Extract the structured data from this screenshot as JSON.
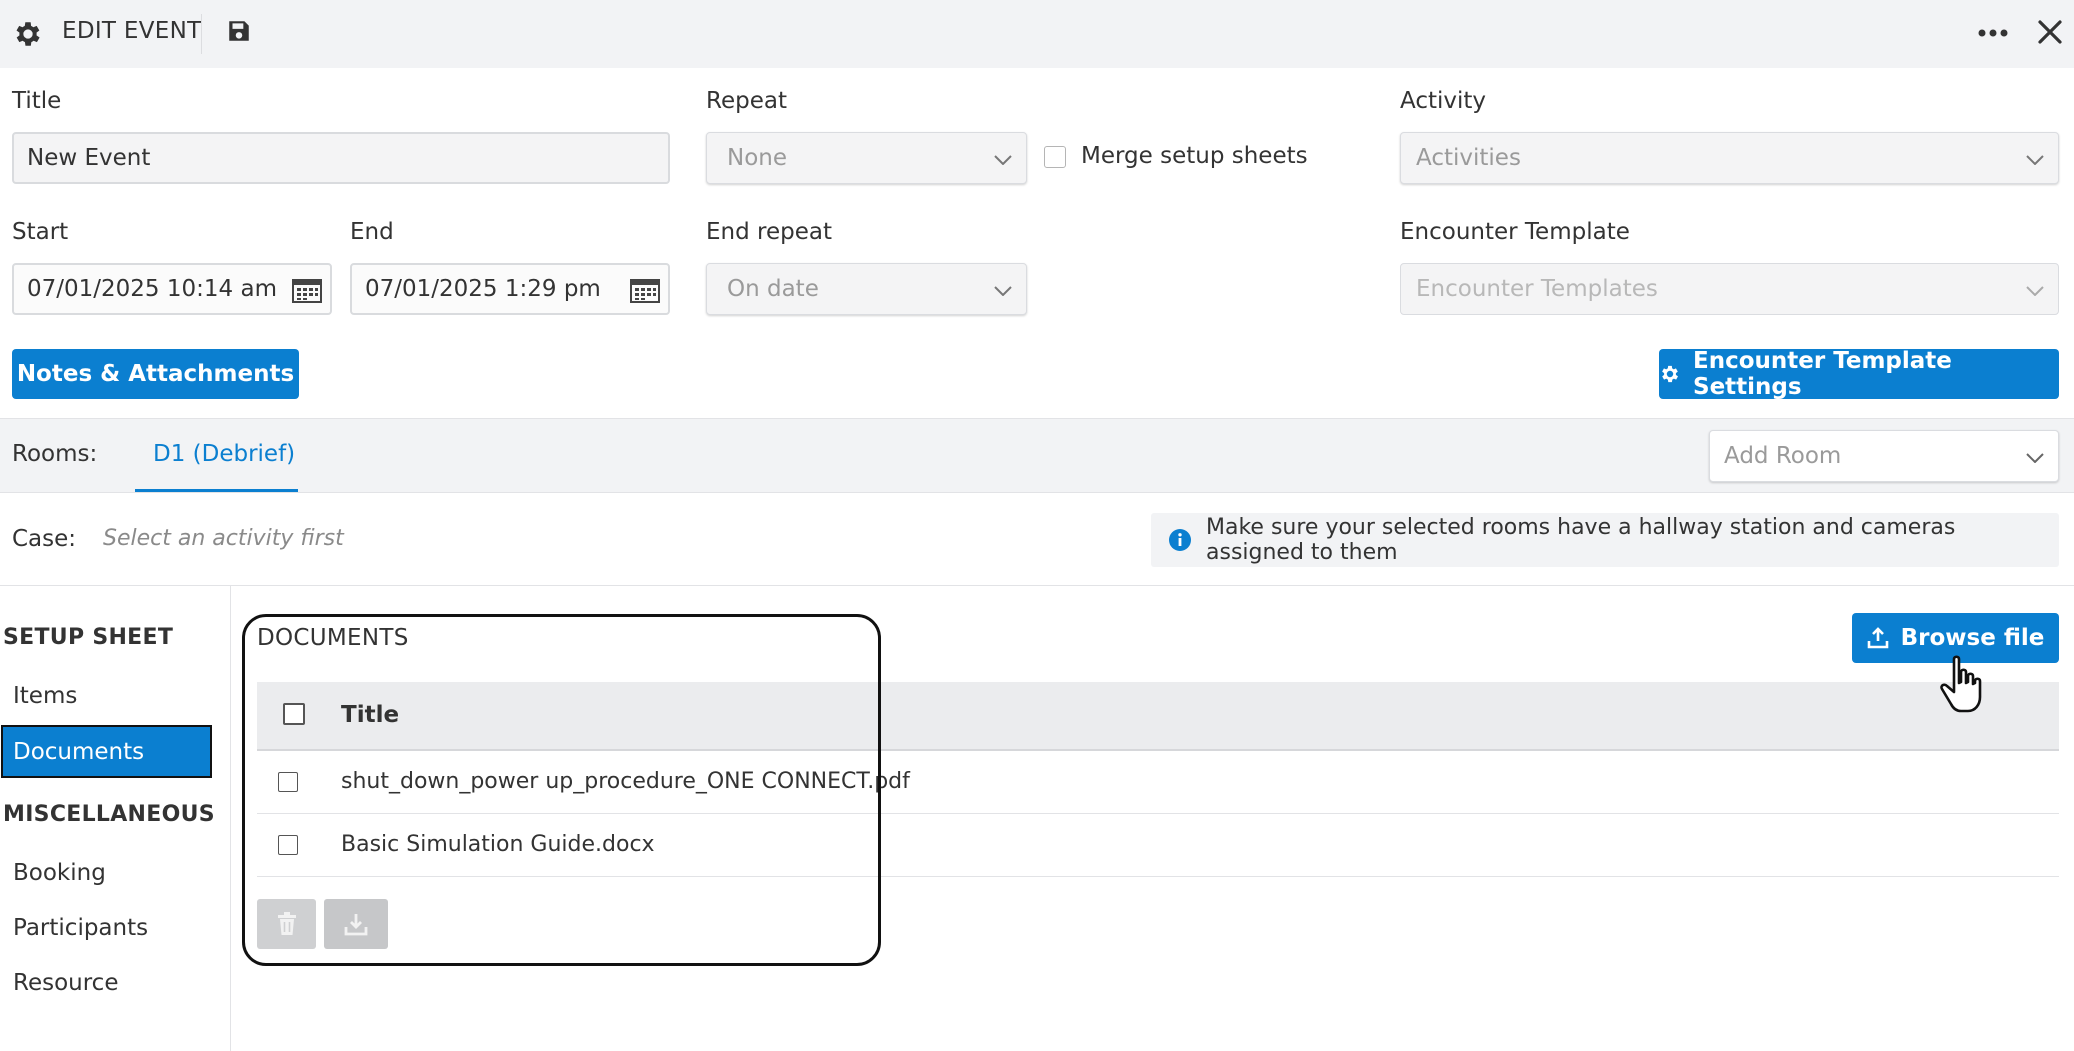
{
  "header": {
    "title": "EDIT EVENT",
    "icons": [
      "gear-icon",
      "save-icon",
      "more-icon",
      "close-icon"
    ]
  },
  "form": {
    "title_label": "Title",
    "title_value": "New Event",
    "repeat_label": "Repeat",
    "repeat_value": "None",
    "merge_label": "Merge setup sheets",
    "activity_label": "Activity",
    "activity_placeholder": "Activities",
    "start_label": "Start",
    "start_value": "07/01/2025 10:14 am",
    "end_label": "End",
    "end_value": "07/01/2025 1:29 pm",
    "end_repeat_label": "End repeat",
    "end_repeat_value": "On date",
    "encounter_template_label": "Encounter Template",
    "encounter_template_placeholder": "Encounter Templates"
  },
  "actions": {
    "notes_attachments": "Notes & Attachments",
    "encounter_template_settings": "Encounter Template Settings"
  },
  "rooms": {
    "label": "Rooms:",
    "tabs": [
      "D1 (Debrief)"
    ],
    "add_room_placeholder": "Add Room"
  },
  "case": {
    "label": "Case:",
    "placeholder": "Select an activity first",
    "info_text": "Make sure your selected rooms have a hallway station and cameras assigned to them"
  },
  "sidebar": {
    "setup_sheet_title": "SETUP SHEET",
    "setup_items": [
      "Items",
      "Documents"
    ],
    "misc_title": "MISCELLANEOUS",
    "misc_items": [
      "Booking",
      "Participants",
      "Resource"
    ],
    "selected": "Documents"
  },
  "documents": {
    "title": "DOCUMENTS",
    "browse_button": "Browse file",
    "column_title": "Title",
    "rows": [
      {
        "name": "shut_down_power up_procedure_ONE CONNECT.pdf"
      },
      {
        "name": "Basic Simulation Guide.docx"
      }
    ]
  },
  "colors": {
    "primary": "#0b7fd0",
    "header_bg": "#f2f3f5"
  }
}
